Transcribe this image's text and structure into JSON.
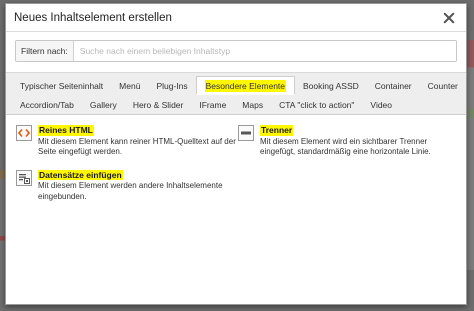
{
  "dialog": {
    "title": "Neues Inhaltselement erstellen"
  },
  "filter": {
    "label": "Filtern nach:",
    "placeholder": "Suche nach einem beliebigen Inhaltstyp",
    "value": ""
  },
  "tabs": {
    "row1": [
      {
        "label": "Typischer Seiteninhalt",
        "active": false
      },
      {
        "label": "Menü",
        "active": false
      },
      {
        "label": "Plug-Ins",
        "active": false
      },
      {
        "label": "Besondere Elemente",
        "active": true
      },
      {
        "label": "Booking ASSD",
        "active": false
      },
      {
        "label": "Container",
        "active": false
      },
      {
        "label": "Counter",
        "active": false
      }
    ],
    "row2": [
      {
        "label": "Accordion/Tab"
      },
      {
        "label": "Gallery"
      },
      {
        "label": "Hero & Slider"
      },
      {
        "label": "IFrame"
      },
      {
        "label": "Maps"
      },
      {
        "label": "CTA \"click to action\""
      },
      {
        "label": "Video"
      }
    ]
  },
  "elements": [
    {
      "icon": "html-code-icon",
      "title": "Reines HTML",
      "description_line1": "Mit diesem Element kann reiner HTML-Quelltext auf der",
      "description_line2": "Seite eingefügt werden."
    },
    {
      "icon": "divider-icon",
      "title": "Trenner",
      "description_line1": "Mit diesem Element wird ein sichtbarer Trenner",
      "description_line2": "eingefügt, standardmäßig eine horizontale Linie."
    },
    {
      "icon": "insert-records-icon",
      "title": "Datensätze einfügen",
      "description_line1": "Mit diesem Element werden andere Inhaltselemente",
      "description_line2": "eingebunden."
    }
  ],
  "colors": {
    "highlight": "#fff700",
    "html_icon_accent": "#e8590c",
    "tab_bar_bg": "#eeeeee"
  }
}
